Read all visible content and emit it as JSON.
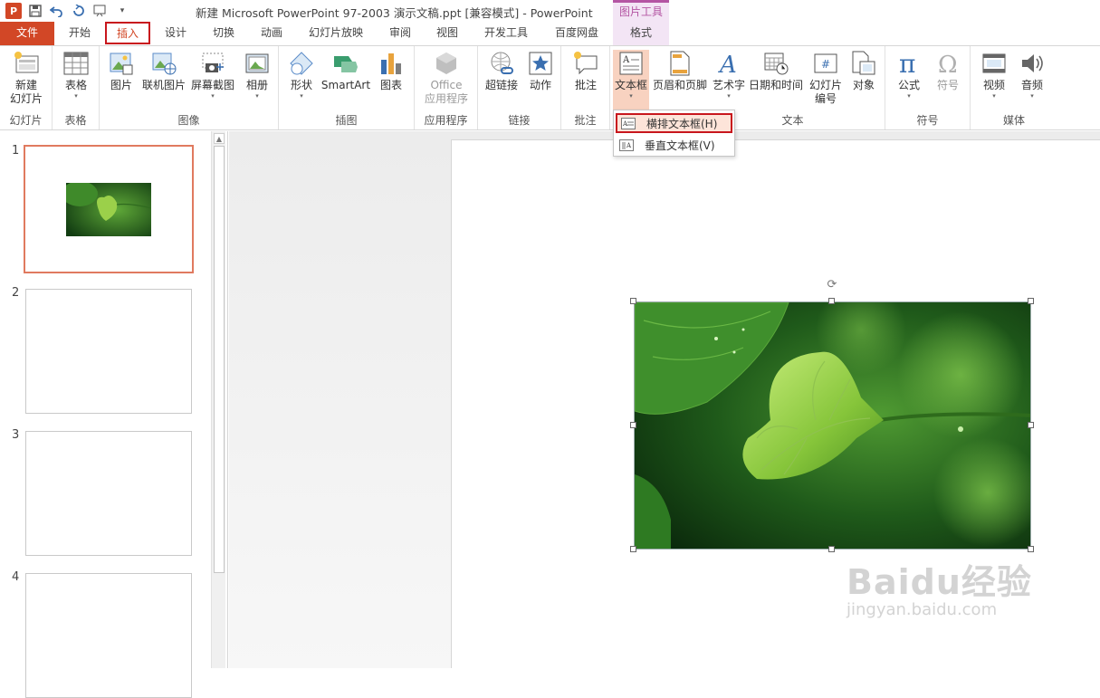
{
  "title_bar": {
    "app_logo": "P",
    "window_title": "新建 Microsoft PowerPoint 97-2003 演示文稿.ppt [兼容模式] - PowerPoint",
    "contextual_tab_group": "图片工具",
    "qat_icons": [
      "save-icon",
      "undo-icon",
      "redo-icon",
      "start-from-beginning-icon",
      "customize-qat-icon"
    ]
  },
  "tabs": {
    "file": "文件",
    "home": "开始",
    "insert": "插入",
    "design": "设计",
    "transitions": "切换",
    "animations": "动画",
    "slideshow": "幻灯片放映",
    "review": "审阅",
    "view": "视图",
    "developer": "开发工具",
    "baidu": "百度网盘",
    "format": "格式"
  },
  "ribbon": {
    "slides": {
      "label": "幻灯片",
      "new_slide_line1": "新建",
      "new_slide_line2": "幻灯片"
    },
    "tables": {
      "label": "表格",
      "table": "表格"
    },
    "images": {
      "label": "图像",
      "picture": "图片",
      "online_picture": "联机图片",
      "screenshot": "屏幕截图",
      "album": "相册"
    },
    "illustrations": {
      "label": "插图",
      "shapes": "形状",
      "smartart": "SmartArt",
      "chart": "图表"
    },
    "apps": {
      "label": "应用程序",
      "office_line1": "Office",
      "office_line2": "应用程序"
    },
    "links": {
      "label": "链接",
      "hyperlink": "超链接",
      "action": "动作"
    },
    "comments": {
      "label": "批注",
      "comment": "批注"
    },
    "text": {
      "label": "文本",
      "textbox": "文本框",
      "header_footer": "页眉和页脚",
      "wordart": "艺术字",
      "datetime": "日期和时间",
      "slide_num_line1": "幻灯片",
      "slide_num_line2": "编号",
      "object": "对象"
    },
    "symbols": {
      "label": "符号",
      "equation": "公式",
      "symbol": "符号"
    },
    "media": {
      "label": "媒体",
      "video": "视频",
      "audio": "音频"
    }
  },
  "textbox_menu": {
    "horizontal": "横排文本框(H)",
    "vertical": "垂直文本框(V)"
  },
  "slides_pane": {
    "numbers": [
      "1",
      "2",
      "3",
      "4"
    ]
  },
  "watermark": {
    "line1": "Baidu经验",
    "line2": "jingyan.baidu.com"
  },
  "colors": {
    "accent": "#d24726",
    "highlight_border": "#c8161d",
    "contextual": "#b455a3"
  }
}
